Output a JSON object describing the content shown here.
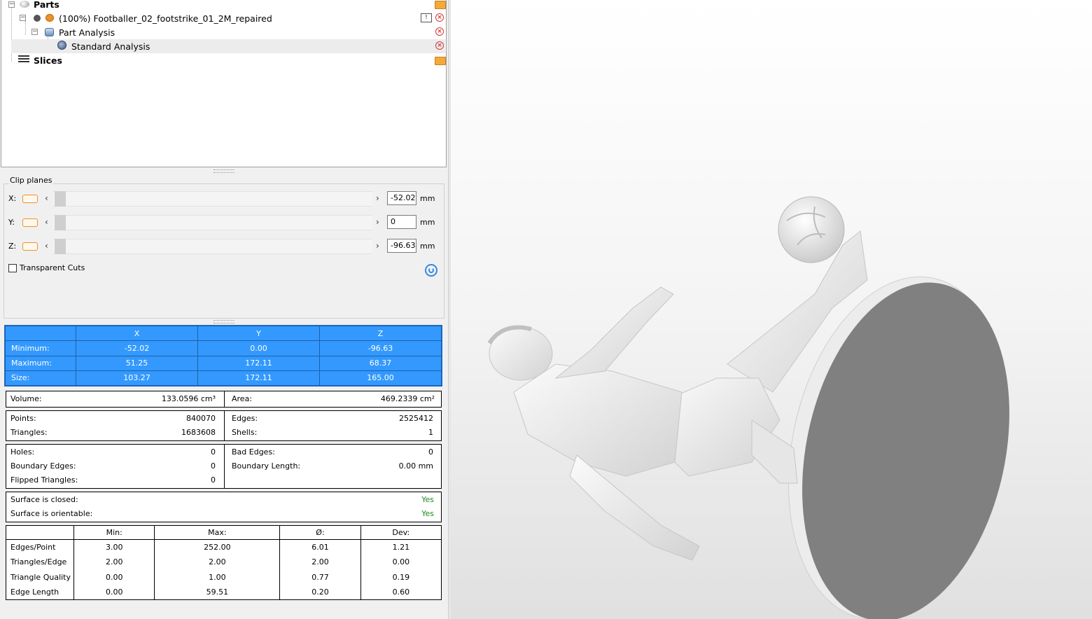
{
  "tree": {
    "parts_label": "Parts",
    "part_label": "(100%) Footballer_02_footstrike_01_2M_repaired",
    "analysis_label": "Part Analysis",
    "standard_label": "Standard Analysis",
    "slices_label": "Slices"
  },
  "clip": {
    "title": "Clip planes",
    "x_label": "X:",
    "y_label": "Y:",
    "z_label": "Z:",
    "x_value": "-52.02",
    "y_value": "0",
    "z_value": "-96.63",
    "unit": "mm",
    "transparent_label": "Transparent Cuts"
  },
  "bounds": {
    "headers": [
      "X",
      "Y",
      "Z"
    ],
    "rows": [
      {
        "label": "Minimum:",
        "x": "-52.02",
        "y": "0.00",
        "z": "-96.63"
      },
      {
        "label": "Maximum:",
        "x": "51.25",
        "y": "172.11",
        "z": "68.37"
      },
      {
        "label": "Size:",
        "x": "103.27",
        "y": "172.11",
        "z": "165.00"
      }
    ]
  },
  "stats": {
    "volume_label": "Volume:",
    "volume_value": "133.0596 cm³",
    "area_label": "Area:",
    "area_value": "469.2339 cm²",
    "points_label": "Points:",
    "points_value": "840070",
    "triangles_label": "Triangles:",
    "triangles_value": "1683608",
    "edges_label": "Edges:",
    "edges_value": "2525412",
    "shells_label": "Shells:",
    "shells_value": "1",
    "holes_label": "Holes:",
    "holes_value": "0",
    "boundary_edges_label": "Boundary Edges:",
    "boundary_edges_value": "0",
    "flipped_label": "Flipped Triangles:",
    "flipped_value": "0",
    "bad_edges_label": "Bad Edges:",
    "bad_edges_value": "0",
    "boundary_length_label": "Boundary Length:",
    "boundary_length_value": "0.00 mm",
    "closed_label": "Surface is closed:",
    "closed_value": "Yes",
    "orientable_label": "Surface is orientable:",
    "orientable_value": "Yes"
  },
  "quality": {
    "headers": [
      "Min:",
      "Max:",
      "Ø:",
      "Dev:"
    ],
    "rows": [
      {
        "label": "Edges/Point",
        "min": "3.00",
        "max": "252.00",
        "avg": "6.01",
        "dev": "1.21"
      },
      {
        "label": "Triangles/Edge",
        "min": "2.00",
        "max": "2.00",
        "avg": "2.00",
        "dev": "0.00"
      },
      {
        "label": "Triangle Quality",
        "min": "0.00",
        "max": "1.00",
        "avg": "0.77",
        "dev": "0.19"
      },
      {
        "label": "Edge Length",
        "min": "0.00",
        "max": "59.51",
        "avg": "0.20",
        "dev": "0.60"
      }
    ]
  },
  "colors": {
    "selection_blue": "#3399ff",
    "ok_green": "#1f8a1f",
    "close_red": "#d23a3a",
    "model_grey": "#808080"
  }
}
